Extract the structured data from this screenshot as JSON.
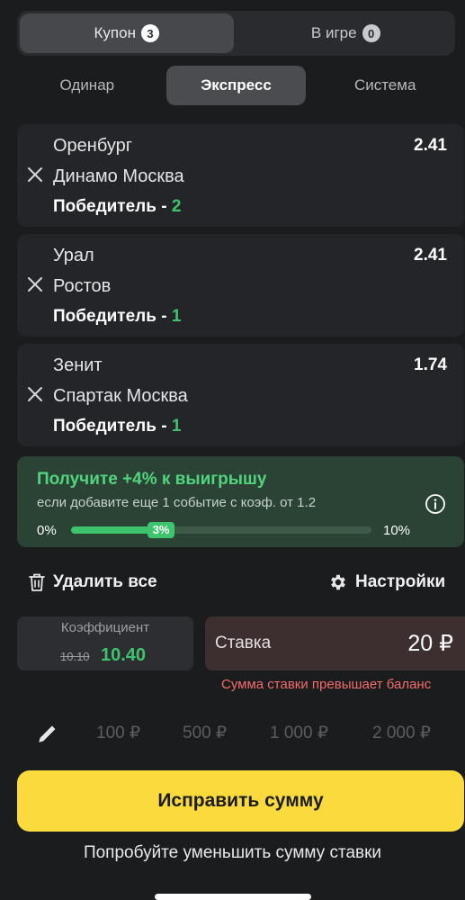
{
  "top_tabs": [
    {
      "label": "Купон",
      "count": "3"
    },
    {
      "label": "В игре",
      "count": "0"
    }
  ],
  "bet_types": [
    "Одинар",
    "Экспресс",
    "Система"
  ],
  "events": [
    {
      "team1": "Оренбург",
      "team2": "Динамо Москва",
      "market": "Победитель - ",
      "selection": "2",
      "odds": "2.41"
    },
    {
      "team1": "Урал",
      "team2": "Ростов",
      "market": "Победитель - ",
      "selection": "1",
      "odds": "2.41"
    },
    {
      "team1": "Зенит",
      "team2": "Спартак Москва",
      "market": "Победитель - ",
      "selection": "1",
      "odds": "1.74"
    }
  ],
  "promo": {
    "title": "Получите +4% к выигрышу",
    "subtitle": "если добавите еще 1 событие с коэф. от 1.2",
    "min_label": "0%",
    "max_label": "10%",
    "current_label": "3%",
    "progress_fraction": 0.3
  },
  "actions": {
    "delete_all": "Удалить все",
    "settings": "Настройки"
  },
  "coefficient": {
    "label": "Коэффициент",
    "old": "10.10",
    "new": "10.40"
  },
  "stake": {
    "label": "Ставка",
    "value": "20 ₽",
    "error": "Сумма ставки превышает баланс"
  },
  "quick_amounts": [
    "100 ₽",
    "500 ₽",
    "1 000 ₽",
    "2 000 ₽"
  ],
  "primary_button": "Исправить сумму",
  "hint": "Попробуйте уменьшить сумму ставки",
  "colors": {
    "accent_green": "#3ec46d",
    "button_yellow": "#fada3c",
    "error_red": "#f26b6b",
    "background": "#1b1c1e"
  }
}
